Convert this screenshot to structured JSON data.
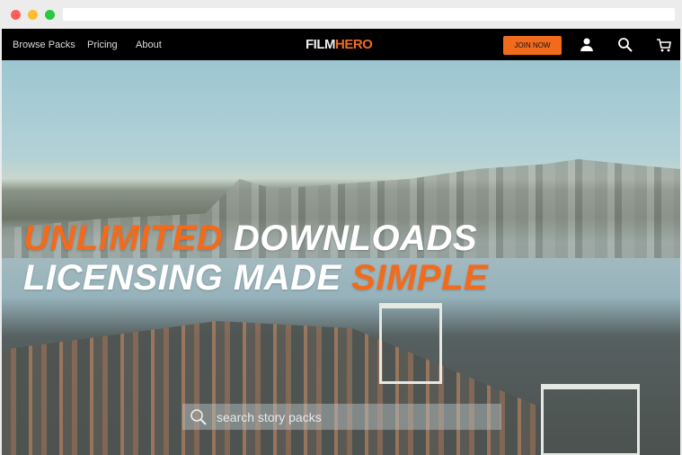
{
  "browser": {
    "dots": [
      "#fe5f57",
      "#febc2e",
      "#28c840"
    ]
  },
  "nav": {
    "links": [
      "Browse Packs",
      "Pricing",
      "About"
    ],
    "logo": {
      "part1": "FILM",
      "part2": "HERO"
    },
    "join_label": "JOIN NOW",
    "icons": [
      "user-icon",
      "search-icon",
      "cart-icon"
    ]
  },
  "hero": {
    "line1_orange": "UNLIMITED",
    "line1_white": " DOWNLOADS",
    "line2_white": "LICENSING MADE ",
    "line2_orange": "SIMPLE",
    "search_placeholder": "search story packs"
  },
  "colors": {
    "accent": "#f26b1d",
    "nav_bg": "#000000"
  }
}
